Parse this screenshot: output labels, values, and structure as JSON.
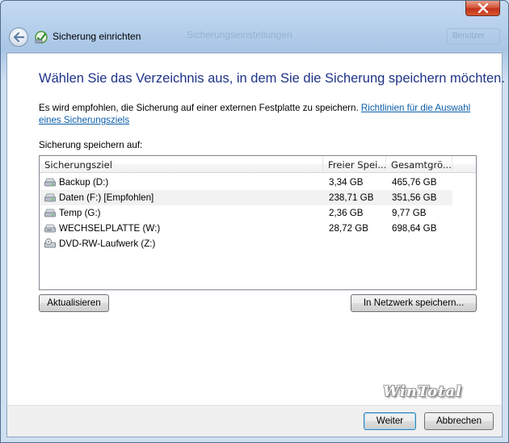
{
  "window": {
    "title": "Sicherung einrichten",
    "ghost_title": "Sicherungseinstellungen",
    "ghost_button": "Benutzer",
    "close_icon": "close-icon",
    "back_icon": "back-arrow-icon"
  },
  "page": {
    "heading": "Wählen Sie das Verzeichnis aus, in dem Sie die Sicherung speichern möchten.",
    "description": "Es wird empfohlen, die Sicherung auf einer externen Festplatte zu speichern. ",
    "link_text": "Richtlinien für die Auswahl eines Sicherungsziels",
    "save_label": "Sicherung speichern auf:"
  },
  "table": {
    "columns": [
      "Sicherungsziel",
      "Freier Spei...",
      "Gesamtgrö..."
    ],
    "rows": [
      {
        "name": "Backup (D:)",
        "free": "3,34 GB",
        "total": "465,76 GB",
        "icon": "hard-drive-icon"
      },
      {
        "name": "Daten (F:) [Empfohlen]",
        "free": "238,71 GB",
        "total": "351,56 GB",
        "icon": "hard-drive-icon"
      },
      {
        "name": "Temp (G:)",
        "free": "2,36 GB",
        "total": "9,77 GB",
        "icon": "hard-drive-icon"
      },
      {
        "name": "WECHSELPLATTE (W:)",
        "free": "28,72 GB",
        "total": "698,64 GB",
        "icon": "removable-drive-icon"
      },
      {
        "name": "DVD-RW-Laufwerk (Z:)",
        "free": "",
        "total": "",
        "icon": "dvd-drive-icon"
      }
    ],
    "selected_index": 1
  },
  "buttons": {
    "refresh": "Aktualisieren",
    "network": "In Netzwerk speichern...",
    "next": "Weiter",
    "cancel": "Abbrechen"
  },
  "watermark": "WinTotal",
  "colors": {
    "heading": "#1e3287",
    "link": "#0b5ea8",
    "close_button": "#c4311a"
  }
}
